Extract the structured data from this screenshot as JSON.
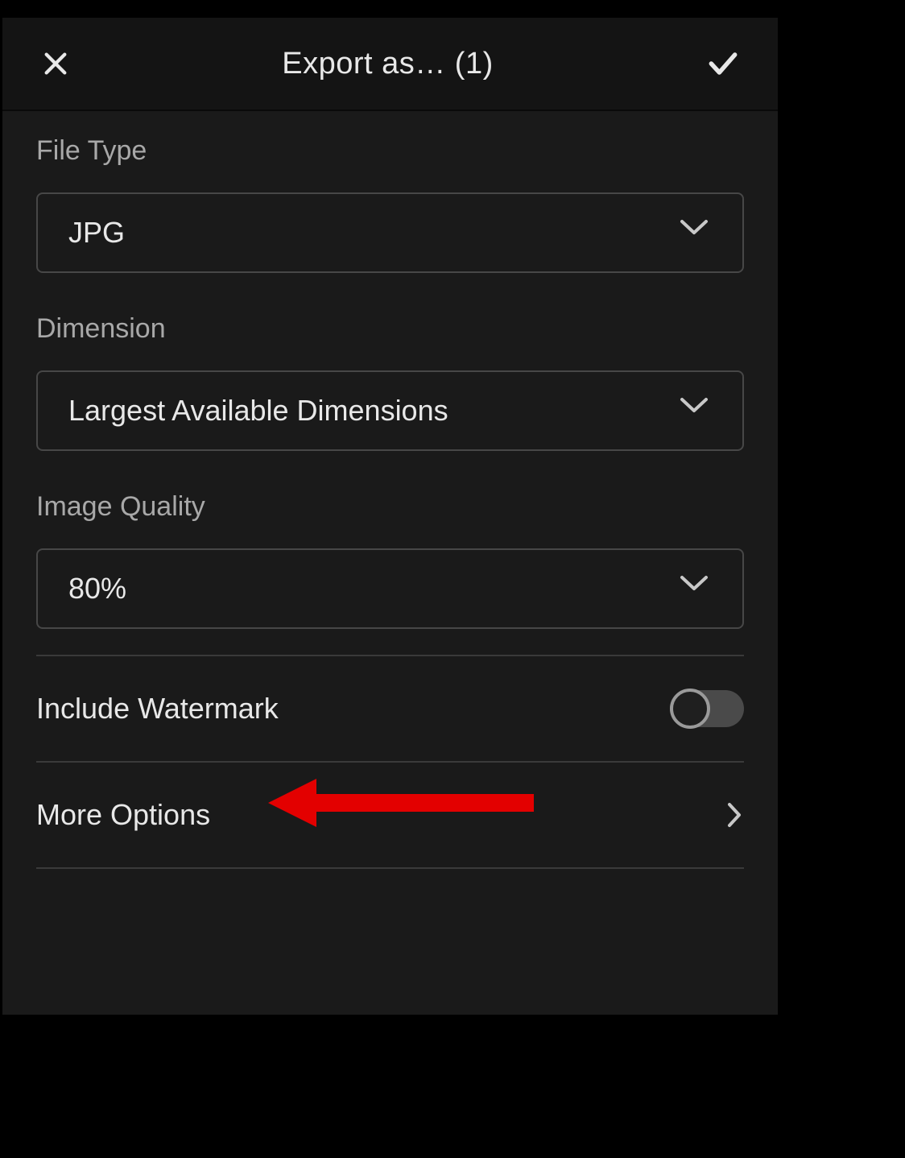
{
  "header": {
    "title": "Export as… (1)"
  },
  "fields": {
    "fileType": {
      "label": "File Type",
      "value": "JPG"
    },
    "dimension": {
      "label": "Dimension",
      "value": "Largest Available Dimensions"
    },
    "imageQuality": {
      "label": "Image Quality",
      "value": "80%"
    }
  },
  "rows": {
    "watermark": {
      "label": "Include Watermark",
      "enabled": false
    },
    "moreOptions": {
      "label": "More Options"
    }
  },
  "annotation": {
    "type": "arrow",
    "color": "#e30000",
    "points_to": "more-options-row"
  }
}
